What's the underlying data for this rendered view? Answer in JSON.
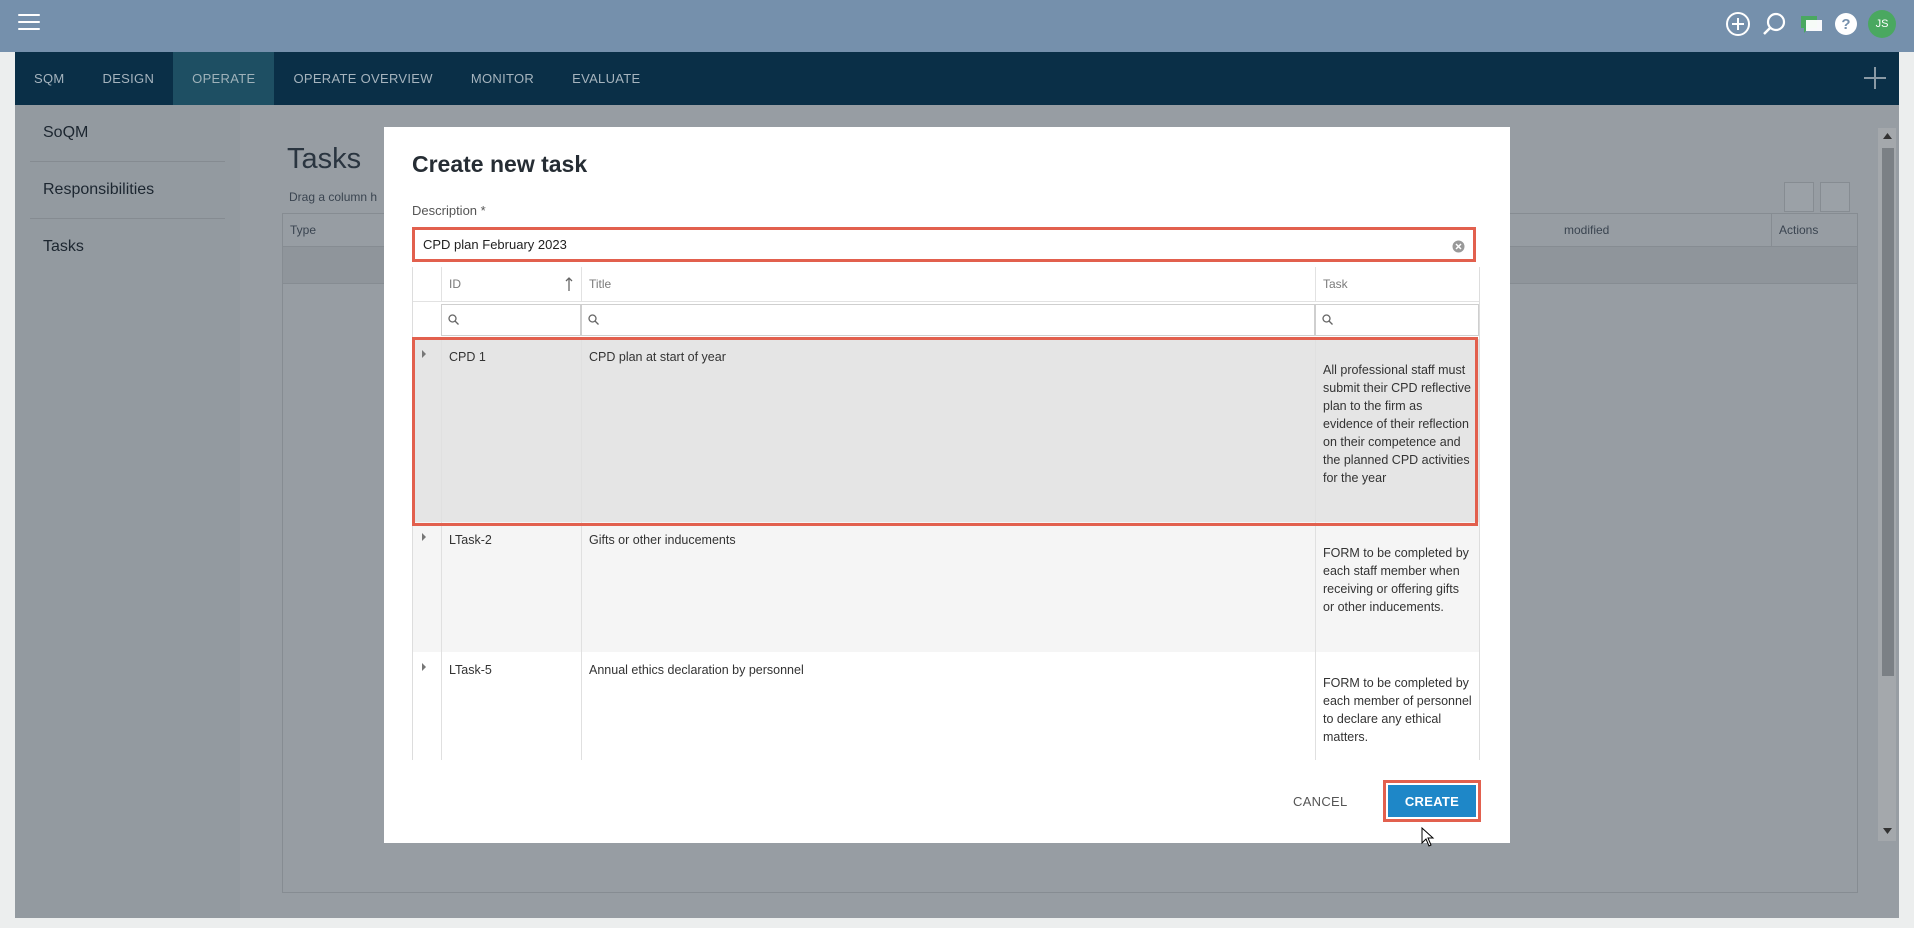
{
  "topbar": {
    "user_initials": "JS",
    "icons": [
      "menu-icon",
      "add-circle-icon",
      "search-icon",
      "chat-icon",
      "help-icon"
    ]
  },
  "nav": {
    "tabs": [
      {
        "label": "SQM",
        "active": false
      },
      {
        "label": "DESIGN",
        "active": false
      },
      {
        "label": "OPERATE",
        "active": true
      },
      {
        "label": "OPERATE OVERVIEW",
        "active": false
      },
      {
        "label": "MONITOR",
        "active": false
      },
      {
        "label": "EVALUATE",
        "active": false
      }
    ]
  },
  "sidebar": {
    "items": [
      {
        "label": "SoQM"
      },
      {
        "label": "Responsibilities"
      },
      {
        "label": "Tasks"
      }
    ]
  },
  "background": {
    "title": "Tasks",
    "hint": "Drag a column h",
    "columns": {
      "type": "Type",
      "modified": "modified",
      "actions": "Actions"
    }
  },
  "modal": {
    "title": "Create new task",
    "description_label": "Description *",
    "description_value": "CPD plan February 2023",
    "grid": {
      "columns": {
        "id": "ID",
        "title": "Title",
        "task": "Task"
      },
      "sort": "ascending",
      "rows": [
        {
          "id": "CPD 1",
          "title": "CPD plan at start of year",
          "task": "All professional staff must submit their CPD reflective plan to the firm as evidence of their reflection on their competence and the planned CPD activities for the year",
          "selected": true
        },
        {
          "id": "LTask-2",
          "title": "Gifts or other inducements",
          "task": "FORM to be completed by each staff member when receiving or offering gifts or other inducements.",
          "selected": false
        },
        {
          "id": "LTask-5",
          "title": "Annual ethics declaration by personnel",
          "task": "FORM to be completed by each member of personnel to declare any ethical matters.",
          "selected": false
        }
      ]
    },
    "cancel_label": "CANCEL",
    "create_label": "CREATE"
  },
  "colors": {
    "highlight": "#e2604e",
    "primary": "#1e87c8",
    "nav_bg": "#0a2f47",
    "topbar_bg": "#7590ac"
  }
}
